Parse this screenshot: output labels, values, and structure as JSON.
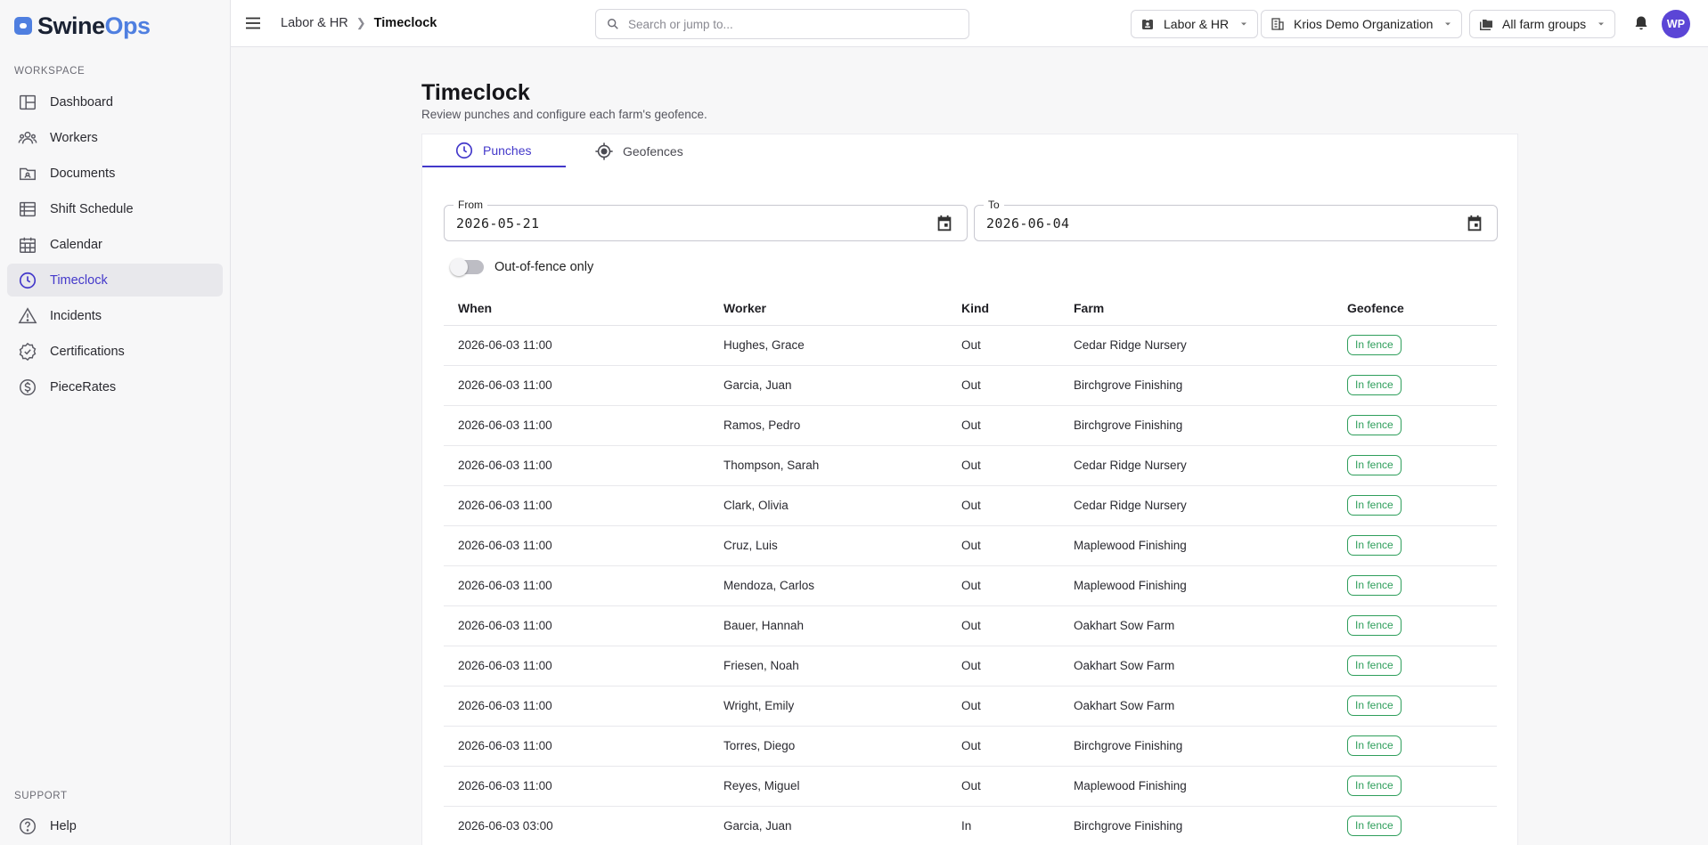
{
  "app": {
    "name_part1": "Swine",
    "name_part2": "Ops",
    "accent_color": "#4338ca",
    "logo_color": "#4f7fe0"
  },
  "sidebar": {
    "workspace_label": "WORKSPACE",
    "support_label": "SUPPORT",
    "items": [
      {
        "label": "Dashboard",
        "icon": "dashboard-icon"
      },
      {
        "label": "Workers",
        "icon": "people-icon"
      },
      {
        "label": "Documents",
        "icon": "folder-icon"
      },
      {
        "label": "Shift Schedule",
        "icon": "schedule-icon"
      },
      {
        "label": "Calendar",
        "icon": "calendar-icon"
      },
      {
        "label": "Timeclock",
        "icon": "clock-icon",
        "active": true
      },
      {
        "label": "Incidents",
        "icon": "warning-icon"
      },
      {
        "label": "Certifications",
        "icon": "badge-check-icon"
      },
      {
        "label": "PieceRates",
        "icon": "dollar-icon"
      }
    ],
    "help_label": "Help"
  },
  "topbar": {
    "breadcrumb": [
      "Labor & HR",
      "Timeclock"
    ],
    "search_placeholder": "Search or jump to...",
    "module_select": "Labor & HR",
    "org_select": "Krios Demo Organization",
    "farm_group_select": "All farm groups",
    "avatar_initials": "WP"
  },
  "page": {
    "title": "Timeclock",
    "subtitle": "Review punches and configure each farm's geofence.",
    "tabs": [
      {
        "label": "Punches",
        "icon": "clock-icon",
        "active": true
      },
      {
        "label": "Geofences",
        "icon": "target-icon",
        "active": false
      }
    ],
    "from": {
      "label": "From",
      "value": "2026-05-21"
    },
    "to": {
      "label": "To",
      "value": "2026-06-04"
    },
    "toggle_label": "Out-of-fence only",
    "toggle_on": false
  },
  "table": {
    "columns": [
      "When",
      "Worker",
      "Kind",
      "Farm",
      "Geofence"
    ],
    "rows": [
      {
        "when": "2026-06-03 11:00",
        "worker": "Hughes, Grace",
        "kind": "Out",
        "farm": "Cedar Ridge Nursery",
        "geofence": "In fence"
      },
      {
        "when": "2026-06-03 11:00",
        "worker": "Garcia, Juan",
        "kind": "Out",
        "farm": "Birchgrove Finishing",
        "geofence": "In fence"
      },
      {
        "when": "2026-06-03 11:00",
        "worker": "Ramos, Pedro",
        "kind": "Out",
        "farm": "Birchgrove Finishing",
        "geofence": "In fence"
      },
      {
        "when": "2026-06-03 11:00",
        "worker": "Thompson, Sarah",
        "kind": "Out",
        "farm": "Cedar Ridge Nursery",
        "geofence": "In fence"
      },
      {
        "when": "2026-06-03 11:00",
        "worker": "Clark, Olivia",
        "kind": "Out",
        "farm": "Cedar Ridge Nursery",
        "geofence": "In fence"
      },
      {
        "when": "2026-06-03 11:00",
        "worker": "Cruz, Luis",
        "kind": "Out",
        "farm": "Maplewood Finishing",
        "geofence": "In fence"
      },
      {
        "when": "2026-06-03 11:00",
        "worker": "Mendoza, Carlos",
        "kind": "Out",
        "farm": "Maplewood Finishing",
        "geofence": "In fence"
      },
      {
        "when": "2026-06-03 11:00",
        "worker": "Bauer, Hannah",
        "kind": "Out",
        "farm": "Oakhart Sow Farm",
        "geofence": "In fence"
      },
      {
        "when": "2026-06-03 11:00",
        "worker": "Friesen, Noah",
        "kind": "Out",
        "farm": "Oakhart Sow Farm",
        "geofence": "In fence"
      },
      {
        "when": "2026-06-03 11:00",
        "worker": "Wright, Emily",
        "kind": "Out",
        "farm": "Oakhart Sow Farm",
        "geofence": "In fence"
      },
      {
        "when": "2026-06-03 11:00",
        "worker": "Torres, Diego",
        "kind": "Out",
        "farm": "Birchgrove Finishing",
        "geofence": "In fence"
      },
      {
        "when": "2026-06-03 11:00",
        "worker": "Reyes, Miguel",
        "kind": "Out",
        "farm": "Maplewood Finishing",
        "geofence": "In fence"
      },
      {
        "when": "2026-06-03 03:00",
        "worker": "Garcia, Juan",
        "kind": "In",
        "farm": "Birchgrove Finishing",
        "geofence": "In fence"
      }
    ],
    "in_fence_color": "#2e9e5b"
  }
}
